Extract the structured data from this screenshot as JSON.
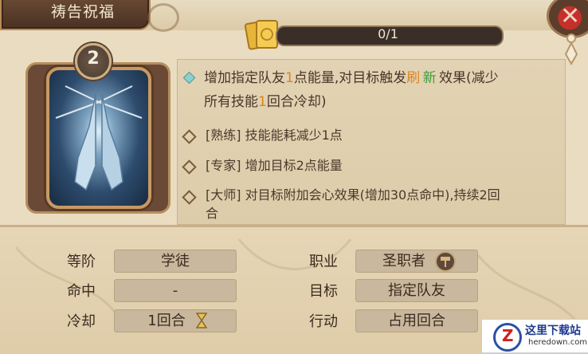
{
  "header": {
    "title": "祷告祝福"
  },
  "skill": {
    "level": "2",
    "progress": {
      "text": "0/1",
      "fraction": 0
    },
    "description": {
      "line1_a": "增加指定队友",
      "line1_b": "1",
      "line1_c": "点能量,对目标触发",
      "line1_d": "刷",
      "line1_e": "新",
      "line1_f": "效果(减少",
      "line2_a": "所有技能",
      "line2_b": "1",
      "line2_c": "回合冷却)"
    },
    "upgrades": [
      {
        "text": "[熟练] 技能能耗减少1点"
      },
      {
        "text": "[专家] 增加目标2点能量"
      },
      {
        "text": "[大师] 对目标附加会心效果(增加30点命中),持续2回",
        "text2": "合"
      }
    ]
  },
  "stats": {
    "rank": {
      "label": "等阶",
      "value": "学徒"
    },
    "hit": {
      "label": "命中",
      "value": "-"
    },
    "cooldown": {
      "label": "冷却",
      "value": "1回合",
      "icon": "hourglass-icon"
    },
    "class": {
      "label": "职业",
      "value": "圣职者",
      "icon": "hammer-icon"
    },
    "target": {
      "label": "目标",
      "value": "指定队友"
    },
    "action": {
      "label": "行动",
      "value": "占用回合"
    }
  },
  "close_icon": "close-icon",
  "watermark": {
    "title": "这里下载站",
    "url": "heredown.com",
    "logo_letter": "Z"
  },
  "colors": {
    "accent_orange": "#d9861e",
    "accent_green": "#3e9c3b",
    "close_red": "#c6302a"
  }
}
